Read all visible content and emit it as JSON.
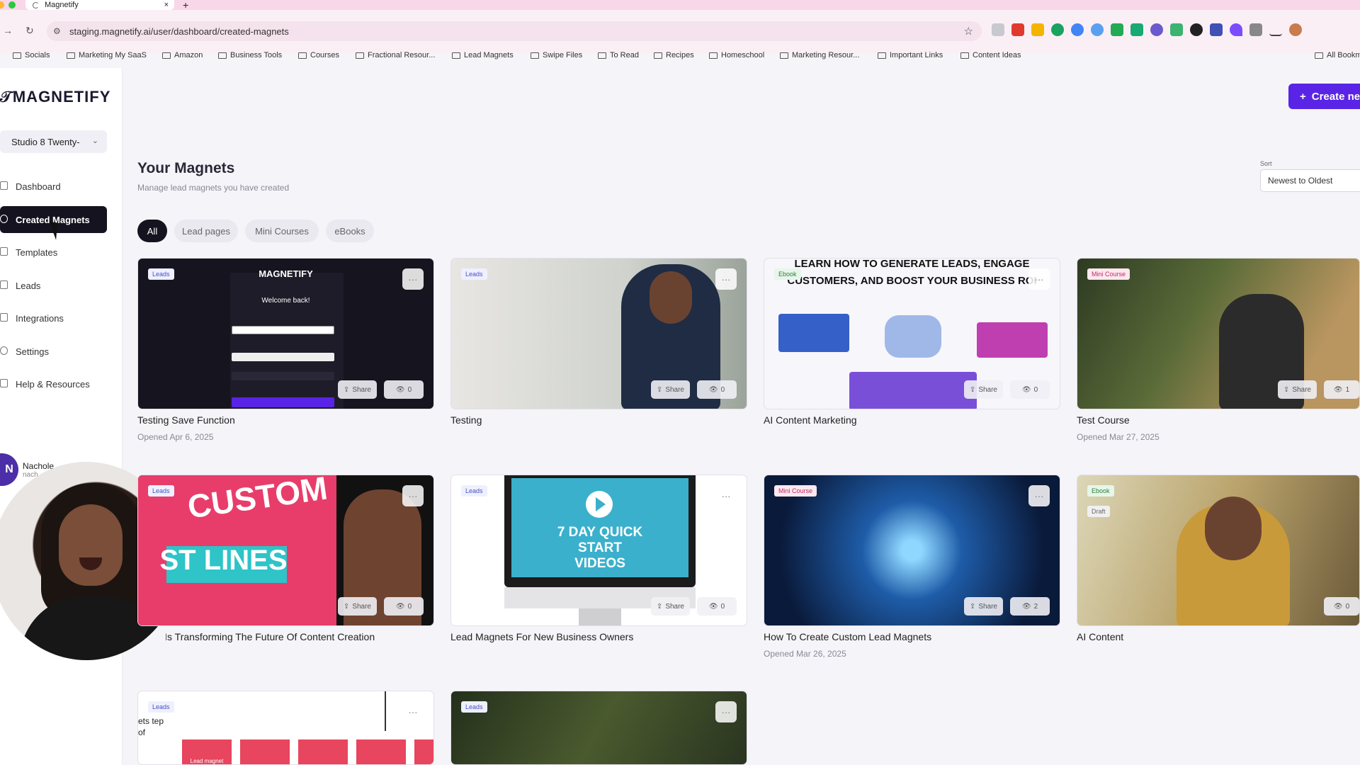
{
  "browser": {
    "tab_title": "Magnetify",
    "tab_close": "×",
    "new_tab": "+",
    "url": "staging.magnetify.ai/user/dashboard/created-magnets",
    "bookmarks": [
      "Socials",
      "Marketing My SaaS",
      "Amazon",
      "Business Tools",
      "Courses",
      "Fractional Resour...",
      "Lead Magnets",
      "Swipe Files",
      "To Read",
      "Recipes",
      "Homeschool",
      "Marketing Resour...",
      "Important Links",
      "Content Ideas"
    ],
    "all_bookmarks": "All Bookm"
  },
  "sidebar": {
    "logo": "MAGNETIFY",
    "workspace": "Studio 8 Twenty-",
    "items": [
      {
        "label": "Dashboard"
      },
      {
        "label": "Created Magnets"
      },
      {
        "label": "Templates"
      },
      {
        "label": "Leads"
      },
      {
        "label": "Integrations"
      },
      {
        "label": "Settings"
      },
      {
        "label": "Help & Resources"
      }
    ],
    "user_name": "Nachole .",
    "user_sub": "nach",
    "user_initial": "N"
  },
  "header": {
    "create_button": "Create ne",
    "title": "Your Magnets",
    "subtitle": "Manage lead magnets you have created",
    "sort_label": "Sort",
    "sort_value": "Newest to Oldest"
  },
  "filters": [
    "All",
    "Lead pages",
    "Mini Courses",
    "eBooks"
  ],
  "cards": [
    {
      "badge": "Leads",
      "title": "Testing Save Function",
      "date": "Opened Apr 6, 2025",
      "views": "0",
      "share": "Share",
      "thumb_logo": "MAGNETIFY",
      "thumb_text": "Welcome back!"
    },
    {
      "badge": "Leads",
      "title": "Testing",
      "date": "",
      "views": "0",
      "share": "Share"
    },
    {
      "badge": "Ebook",
      "title": "AI Content Marketing",
      "date": "",
      "views": "0",
      "share": "Share",
      "thumb_text": "LEARN HOW TO GENERATE LEADS, ENGAGE CUSTOMERS, AND BOOST YOUR BUSINESS ROI"
    },
    {
      "badge": "Mini Course",
      "title": "Test Course",
      "date": "Opened Mar 27, 2025",
      "views": "1",
      "share": "Share"
    },
    {
      "badge": "Leads",
      "title": "ow AI Is Transforming The Future Of Content Creation",
      "date": "",
      "views": "0",
      "share": "Share",
      "thumb_text": "CUSTOM",
      "thumb_text2": "ST LINES"
    },
    {
      "badge": "Leads",
      "title": "Lead Magnets For New Business Owners",
      "date": "",
      "views": "0",
      "share": "Share",
      "thumb_text": "7 DAY QUICK START VIDEOS"
    },
    {
      "badge": "Mini Course",
      "title": "How To Create Custom Lead Magnets",
      "date": "Opened Mar 26, 2025",
      "views": "2",
      "share": "Share"
    },
    {
      "badge": "Ebook",
      "badge2": "Draft",
      "title": "AI Content",
      "date": "",
      "views": "0",
      "share": ""
    },
    {
      "badge": "Leads",
      "title": "",
      "date": "",
      "views": "",
      "share": "",
      "thumb_text": "ets tep of",
      "thumb_text2": "Lead magnet"
    },
    {
      "badge": "Leads",
      "title": "",
      "date": "",
      "views": "",
      "share": ""
    }
  ],
  "icons": {
    "more": "···",
    "eye": "👁",
    "share": "⇪"
  }
}
